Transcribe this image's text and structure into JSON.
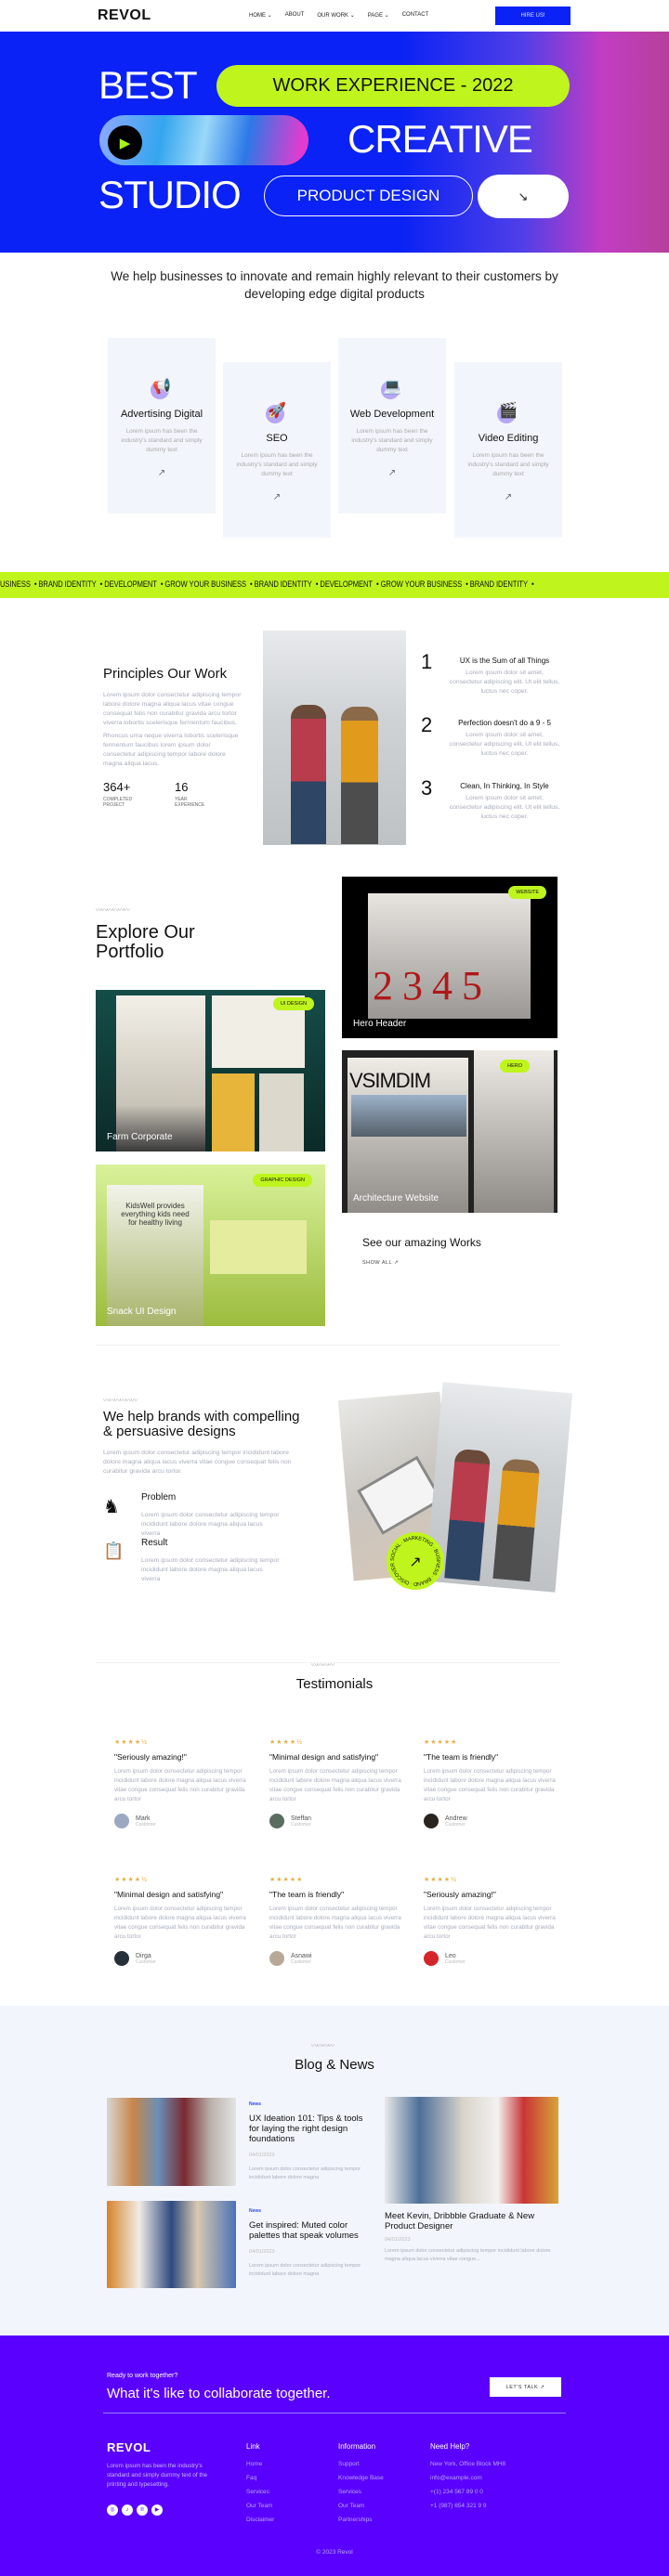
{
  "nav": {
    "logo": "REVOL",
    "links": [
      "HOME",
      "ABOUT",
      "OUR WORK",
      "PAGE",
      "CONTACT"
    ],
    "hire": "HIRE US!"
  },
  "hero": {
    "best": "BEST",
    "badge": "WORK EXPERIENCE - 2022",
    "creative": "CREATIVE",
    "studio": "STUDIO",
    "product": "PRODUCT DESIGN",
    "arrow": "↘"
  },
  "intro": "We help businesses to innovate and remain highly relevant to their customers by developing edge digital products",
  "services": [
    {
      "title": "Advertising Digital",
      "text": "Lorem ipsum has been the industry's standard and simply dummy text",
      "icon": "megaphone-icon"
    },
    {
      "title": "SEO",
      "text": "Lorem ipsum has been the industry's standard and simply dummy text",
      "icon": "rocket-icon"
    },
    {
      "title": "Web Development",
      "text": "Lorem ipsum has been the industry's standard and simply dummy text",
      "icon": "laptop-icon"
    },
    {
      "title": "Video Editing",
      "text": "Lorem ipsum has been the industry's standard and simply dummy text",
      "icon": "video-editor-icon"
    }
  ],
  "marquee": [
    "USINESS",
    "• BRAND IDENTITY",
    "• DEVELOPMENT",
    "• GROW YOUR BUSINESS",
    "• BRAND IDENTITY",
    "• DEVELOPMENT",
    "• GROW YOUR BUSINESS",
    "• BRAND IDENTITY",
    "•"
  ],
  "principles": {
    "title": "Principles Our Work",
    "p1": "Lorem ipsum dolor consectetur adipiscing tempor labore dolore magna aliqua lacus vitae congue consequat felis non curabitur gravida arcu tortor viverra lobortis scelerisque fermentum faucibus.",
    "p2": "Rhoncus urna neque viverra lobortis scelerisque fermentum faucibus lorem ipsum dolor consectetur adipiscing tempor labore dolore magna aliqua lacus.",
    "stats": [
      {
        "value": "364+",
        "label": "COMPLETED PROJECT"
      },
      {
        "value": "16",
        "label": "YEAR EXPERIENCE"
      }
    ],
    "items": [
      {
        "n": "1",
        "title": "UX is the Sum of all Things",
        "text": "Lorem ipsum dolor sit amet, consectetur adipiscing elit. Ut elit tellus, luctus nec coper."
      },
      {
        "n": "2",
        "title": "Perfection doesn't do a 9 - 5",
        "text": "Lorem ipsum dolor sit amet, consectetur adipiscing elit. Ut elit tellus, luctus nec coper."
      },
      {
        "n": "3",
        "title": "Clean, In Thinking, In Style",
        "text": "Lorem ipsum dolor sit amet, consectetur adipiscing elit. Ut elit tellus, luctus nec coper."
      }
    ]
  },
  "portfolio": {
    "title": "Explore Our Portfolio",
    "items": [
      {
        "label": "Hero Header",
        "tag": "WEBSITE"
      },
      {
        "label": "Farm Corporate",
        "tag": "UI DESIGN"
      },
      {
        "label": "Architecture Website",
        "tag": "HERO"
      },
      {
        "label": "Snack UI Design",
        "tag": "GRAPHIC DESIGN"
      }
    ],
    "see": "See our amazing Works",
    "show": "SHOW ALL ↗"
  },
  "brands": {
    "title": "We help brands with compelling & persuasive designs",
    "text": "Lorem ipsum dolor consectetur adipiscing tempor incididunt labore dolore magna aliqua lacus viverra vitae congue consequat felis non curabitur gravida arcu tortor.",
    "items": [
      {
        "title": "Problem",
        "text": "Lorem ipsum dolor consectetur adipiscing tempor incididunt labore dolore magna aliqua lacus viverra",
        "icon": "chess-knight-icon"
      },
      {
        "title": "Result",
        "text": "Lorem ipsum dolor consectetur adipiscing tempor incididunt labore dolore magna aliqua lacus viverra",
        "icon": "clipboard-target-icon"
      }
    ],
    "badge": "SOCIAL · MARKETING · BUSINESS · BRAND · DISCOVER"
  },
  "testimonials": {
    "title": "Testimonials",
    "items": [
      {
        "stars": "★★★★½",
        "rating": 4.5,
        "quote": "\"Seriously amazing!\"",
        "text": "Lorem ipsum dolor consectetur adipiscing tempor incididunt labore dolore magna aliqua lacus viverra vitae congue consequat felis non curabitur gravida arcu tortor",
        "name": "Mark",
        "role": "Customer"
      },
      {
        "stars": "★★★★½",
        "rating": 4.5,
        "quote": "\"Minimal design and satisfying\"",
        "text": "Lorem ipsum dolor consectetur adipiscing tempor incididunt labore dolore magna aliqua lacus viverra vitae congue consequat felis non curabitur gravida arcu tortor",
        "name": "Steffan",
        "role": "Customer"
      },
      {
        "stars": "★★★★★",
        "rating": 5,
        "quote": "\"The team is friendly\"",
        "text": "Lorem ipsum dolor consectetur adipiscing tempor incididunt labore dolore magna aliqua lacus viverra vitae congue consequat felis non curabitur gravida arcu tortor",
        "name": "Andrew",
        "role": "Customer"
      },
      {
        "stars": "★★★★½",
        "rating": 4.5,
        "quote": "\"Minimal design and satisfying\"",
        "text": "Lorem ipsum dolor consectetur adipiscing tempor incididunt labore dolore magna aliqua lacus viverra vitae congue consequat felis non curabitur gravida arcu tortor",
        "name": "Dirga",
        "role": "Customer"
      },
      {
        "stars": "★★★★★",
        "rating": 5,
        "quote": "\"The team is friendly\"",
        "text": "Lorem ipsum dolor consectetur adipiscing tempor incididunt labore dolore magna aliqua lacus viverra vitae congue consequat felis non curabitur gravida arcu tortor",
        "name": "Asnawi",
        "role": "Customer"
      },
      {
        "stars": "★★★★½",
        "rating": 4.5,
        "quote": "\"Seriously amazing!\"",
        "text": "Lorem ipsum dolor consectetur adipiscing tempor incididunt labore dolore magna aliqua lacus viverra vitae congue consequat felis non curabitur gravida arcu tortor",
        "name": "Leo",
        "role": "Customer"
      }
    ]
  },
  "blog": {
    "title": "Blog & News",
    "posts": [
      {
        "cat": "News",
        "title": "UX Ideation 101: Tips & tools for laying the right design foundations",
        "date": "04/01/2023",
        "text": "Lorem ipsum dolor consectetur adipiscing tempor incididunt labore dolore magna"
      },
      {
        "cat": "News",
        "title": "Get inspired: Muted color palettes that speak volumes",
        "date": "04/01/2023",
        "text": "Lorem ipsum dolor consectetur adipiscing tempor incididunt labore dolore magna"
      },
      {
        "title": "Meet Kevin, Dribbble Graduate & New Product Designer",
        "date": "04/01/2023",
        "text": "Lorem ipsum dolor consectetur adipiscing tempor incididunt labore dolore magna aliqua lacus viverra vitae congue..."
      }
    ]
  },
  "footer": {
    "ready": "Ready to work together?",
    "cta": "What it's like to collaborate together.",
    "talk": "LET'S TALK ↗",
    "logo": "REVOL",
    "about": "Lorem ipsum has been the industry's standard and simply dummy text of the printing and typesetting.",
    "social": [
      "dribbble-icon",
      "tiktok-icon",
      "pinterest-icon",
      "youtube-icon"
    ],
    "cols": [
      {
        "title": "Link",
        "items": [
          "Home",
          "Faq",
          "Services",
          "Our Team",
          "Disclaimer"
        ]
      },
      {
        "title": "Information",
        "items": [
          "Support",
          "Knowledge Base",
          "Services",
          "Our Team",
          "Partnerships"
        ]
      },
      {
        "title": "Need Help?",
        "items": [
          "New York, Office Block MH8",
          "info@example.com",
          "+(1) 234 567 89 0 0",
          "+1 (987) 654 321 9 9"
        ]
      }
    ],
    "copyright": "© 2023 Revol"
  },
  "colors": {
    "blue": "#0a22f5",
    "lime": "#bff51c",
    "purple": "#5a00ff",
    "light": "#f3f5fc"
  }
}
